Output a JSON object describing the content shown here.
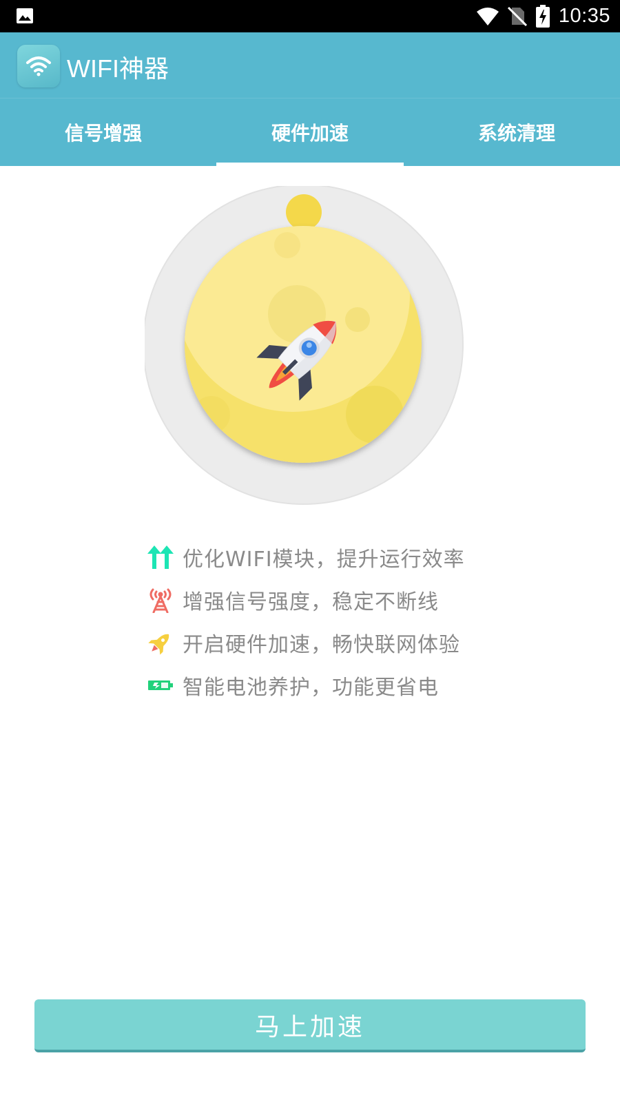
{
  "status_bar": {
    "time": "10:35",
    "icons": [
      "image-icon",
      "wifi-signal-icon",
      "no-sim-icon",
      "battery-charging-icon"
    ]
  },
  "app_bar": {
    "title": "WIFI神器",
    "logo_icon": "wifi-icon"
  },
  "tabs": [
    {
      "label": "信号增强",
      "active": false
    },
    {
      "label": "硬件加速",
      "active": true
    },
    {
      "label": "系统清理",
      "active": false
    }
  ],
  "illustration": {
    "icon": "rocket-icon"
  },
  "features": [
    {
      "icon": "double-arrow-up-icon",
      "text": "优化WIFI模块，提升运行效率",
      "color": "#1de5b4"
    },
    {
      "icon": "signal-tower-icon",
      "text": "增强信号强度，稳定不断线",
      "color": "#ef6c63"
    },
    {
      "icon": "rocket-icon",
      "text": "开启硬件加速，畅快联网体验",
      "color": "#f6cf3f"
    },
    {
      "icon": "battery-icon",
      "text": "智能电池养护，功能更省电",
      "color": "#22d17b"
    }
  ],
  "action_button": {
    "label": "马上加速"
  },
  "colors": {
    "primary": "#57b8cf",
    "button": "#7ad4d2",
    "moon": "#fbe98d",
    "feature_text": "#8a8a8a"
  }
}
